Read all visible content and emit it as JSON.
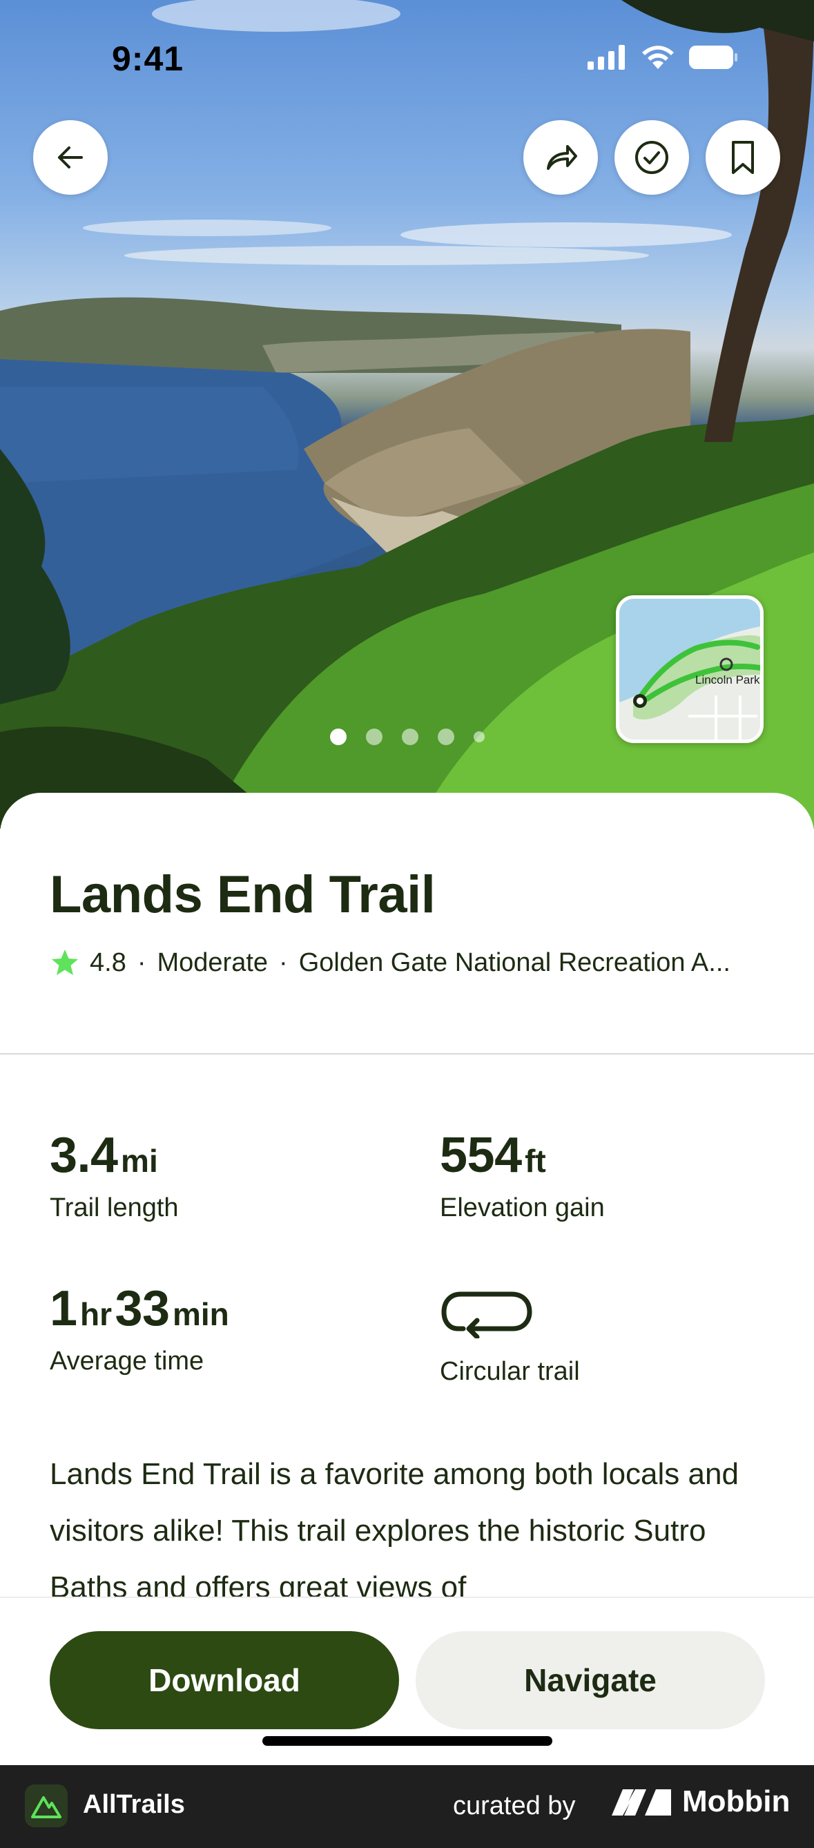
{
  "status_bar": {
    "time": "9:41"
  },
  "hero": {
    "photo_count": 5,
    "active_photo": 1
  },
  "map_thumb": {
    "label": "Lincoln Park"
  },
  "trail": {
    "name": "Lands End Trail",
    "rating": "4.8",
    "difficulty": "Moderate",
    "park": "Golden Gate National Recreation A..."
  },
  "stats": {
    "length_value": "3.4",
    "length_unit": "mi",
    "length_label": "Trail length",
    "elevation_value": "554",
    "elevation_unit": "ft",
    "elevation_label": "Elevation gain",
    "time_hr": "1",
    "time_hr_unit": "hr",
    "time_min": "33",
    "time_min_unit": "min",
    "time_label": "Average time",
    "route_type": "Circular trail"
  },
  "description": "Lands End Trail is a favorite among both locals and visitors alike! This trail explores the historic Sutro Baths and offers great views of",
  "actions": {
    "download_label": "Download",
    "navigate_label": "Navigate"
  },
  "footer": {
    "app_name": "AllTrails",
    "curated_by": "curated by",
    "brand": "Mobbin"
  },
  "colors": {
    "primary_dark_green": "#2c4a12",
    "text": "#1d2b12",
    "star": "#5ee35a"
  }
}
